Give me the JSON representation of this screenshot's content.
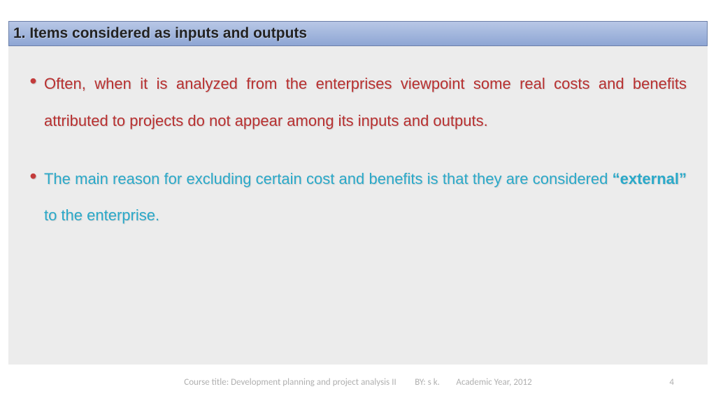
{
  "title": "1. Items considered as inputs and outputs",
  "bullets": [
    {
      "color": "red",
      "text": "Often, when it is analyzed from the enterprises viewpoint some real costs and benefits attributed to projects do not appear among its inputs and outputs."
    },
    {
      "color": "cyan",
      "prefix": "The main reason for excluding certain cost and benefits is that they are considered ",
      "bold": "“external”",
      "suffix": " to the enterprise."
    }
  ],
  "footer": {
    "course": "Course title: Development planning and project analysis II",
    "by": "BY: s k.",
    "year": "Academic Year, 2012",
    "page": "4"
  }
}
